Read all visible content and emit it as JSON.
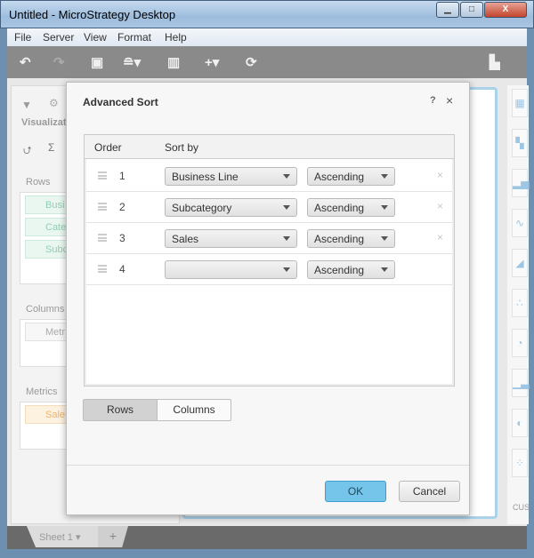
{
  "window": {
    "title": "Untitled - MicroStrategy Desktop",
    "controls": [
      "minimize",
      "maximize",
      "close"
    ]
  },
  "menu": [
    "File",
    "Server",
    "View",
    "Format",
    "Help"
  ],
  "toolbar": {
    "icons": [
      "undo-icon",
      "redo-icon",
      "save-icon",
      "add-data-icon",
      "add-visualization-icon",
      "insert-icon",
      "refresh-icon",
      "new-page-icon"
    ]
  },
  "left_panel": {
    "header": "Visualizat",
    "rows_label": "Rows",
    "rows": [
      "Busi",
      "Cate",
      "Subc"
    ],
    "columns_label": "Columns",
    "columns": [
      "Metr"
    ],
    "metrics_label": "Metrics",
    "metrics": [
      "Sale"
    ]
  },
  "sheet": {
    "tab": "Sheet 1",
    "add": "+"
  },
  "gallery": {
    "label": "CUS"
  },
  "dialog": {
    "title": "Advanced Sort",
    "help": "?",
    "close": "×",
    "headers": {
      "order": "Order",
      "sort_by": "Sort by"
    },
    "rows": [
      {
        "order": "1",
        "field": "Business Line",
        "direction": "Ascending",
        "removable": true
      },
      {
        "order": "2",
        "field": "Subcategory",
        "direction": "Ascending",
        "removable": true
      },
      {
        "order": "3",
        "field": "Sales",
        "direction": "Ascending",
        "removable": true
      },
      {
        "order": "4",
        "field": "",
        "direction": "Ascending",
        "removable": false
      }
    ],
    "remove_glyph": "×",
    "toggle": {
      "rows": "Rows",
      "columns": "Columns",
      "selected": "Rows"
    },
    "ok": "OK",
    "cancel": "Cancel"
  },
  "colors": {
    "accent": "#75c4ea",
    "toolbar": "#8a8a8a",
    "attribute": "#8fcfb3",
    "metric": "#f0b36a"
  }
}
